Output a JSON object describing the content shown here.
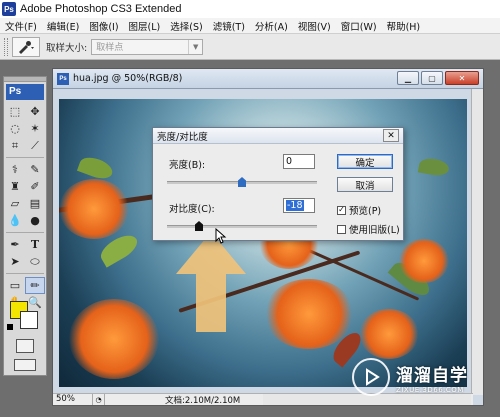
{
  "app": {
    "logo": "Ps",
    "title": "Adobe Photoshop CS3 Extended"
  },
  "menu": [
    "文件(F)",
    "编辑(E)",
    "图像(I)",
    "图层(L)",
    "选择(S)",
    "滤镜(T)",
    "分析(A)",
    "视图(V)",
    "窗口(W)",
    "帮助(H)"
  ],
  "options": {
    "sample_size_label": "取样大小:",
    "sample_size_value": "取样点"
  },
  "toolbox": {
    "logo": "Ps",
    "foreground_color": "#f5e600",
    "background_color": "#ffffff"
  },
  "document": {
    "title": "hua.jpg @ 50%(RGB/8)",
    "zoom": "50%",
    "doc_info": "文档:2.10M/2.10M"
  },
  "dialog": {
    "title": "亮度/对比度",
    "brightness_label": "亮度(B):",
    "brightness_value": "0",
    "brightness_level": 0,
    "contrast_label": "对比度(C):",
    "contrast_value": "-18",
    "contrast_level": -18,
    "ok_label": "确定",
    "cancel_label": "取消",
    "preview_label": "预览(P)",
    "preview_checked": true,
    "legacy_label": "使用旧版(L)",
    "legacy_checked": false
  },
  "watermark": {
    "title": "溜溜自学",
    "subtitle": "ZIXUE.3D66.COM"
  },
  "colors": {
    "accent": "#2d6cc0",
    "arrow": "#f0c27a"
  }
}
